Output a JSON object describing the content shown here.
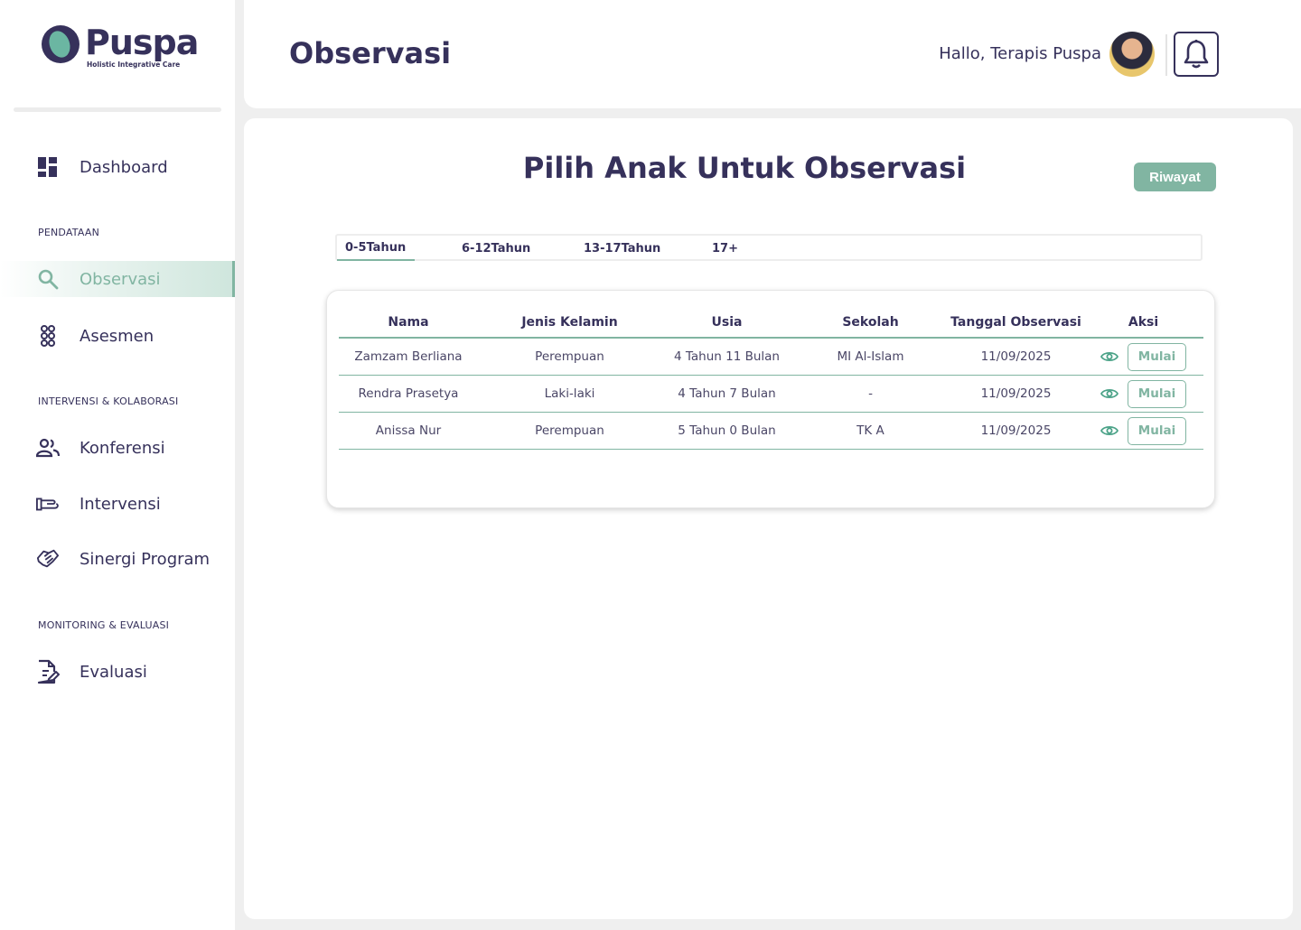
{
  "brand": {
    "name": "Puspa",
    "tagline": "Holistic Integrative Care",
    "primary_color": "#36315b",
    "accent_color": "#81b5a2"
  },
  "sidebar": {
    "dashboard": {
      "label": "Dashboard",
      "icon": "dashboard-icon"
    },
    "sections": [
      {
        "title": "PENDATAAN",
        "items": [
          {
            "label": "Observasi",
            "icon": "search-icon",
            "active": true
          },
          {
            "label": "Asesmen",
            "icon": "asesmen-icon",
            "active": false
          }
        ]
      },
      {
        "title": "INTERVENSI & KOLABORASI",
        "items": [
          {
            "label": "Konferensi",
            "icon": "people-icon",
            "active": false
          },
          {
            "label": "Intervensi",
            "icon": "hand-icon",
            "active": false
          },
          {
            "label": "Sinergi Program",
            "icon": "handshake-icon",
            "active": false
          }
        ]
      },
      {
        "title": "MONITORING & EVALUASI",
        "items": [
          {
            "label": "Evaluasi",
            "icon": "document-edit-icon",
            "active": false
          }
        ]
      }
    ]
  },
  "header": {
    "title": "Observasi",
    "greeting": "Hallo, Terapis Puspa",
    "avatar_icon": "user-avatar",
    "notification_icon": "bell-icon"
  },
  "main": {
    "title": "Pilih Anak Untuk Observasi",
    "history_button": "Riwayat",
    "tabs": [
      {
        "label": "0-5Tahun",
        "active": true
      },
      {
        "label": "6-12Tahun",
        "active": false
      },
      {
        "label": "13-17Tahun",
        "active": false
      },
      {
        "label": "17+",
        "active": false
      }
    ],
    "table": {
      "columns": [
        "Nama",
        "Jenis Kelamin",
        "Usia",
        "Sekolah",
        "Tanggal Observasi",
        "Aksi"
      ],
      "rows": [
        {
          "nama": "Zamzam Berliana",
          "jenis_kelamin": "Perempuan",
          "usia": "4 Tahun 11 Bulan",
          "sekolah": "MI Al-Islam",
          "tanggal": "11/09/2025",
          "action": "Mulai"
        },
        {
          "nama": "Rendra Prasetya",
          "jenis_kelamin": "Laki-laki",
          "usia": "4 Tahun 7 Bulan",
          "sekolah": "-",
          "tanggal": "11/09/2025",
          "action": "Mulai"
        },
        {
          "nama": "Anissa Nur",
          "jenis_kelamin": "Perempuan",
          "usia": "5 Tahun 0 Bulan",
          "sekolah": "TK A",
          "tanggal": "11/09/2025",
          "action": "Mulai"
        }
      ]
    }
  }
}
